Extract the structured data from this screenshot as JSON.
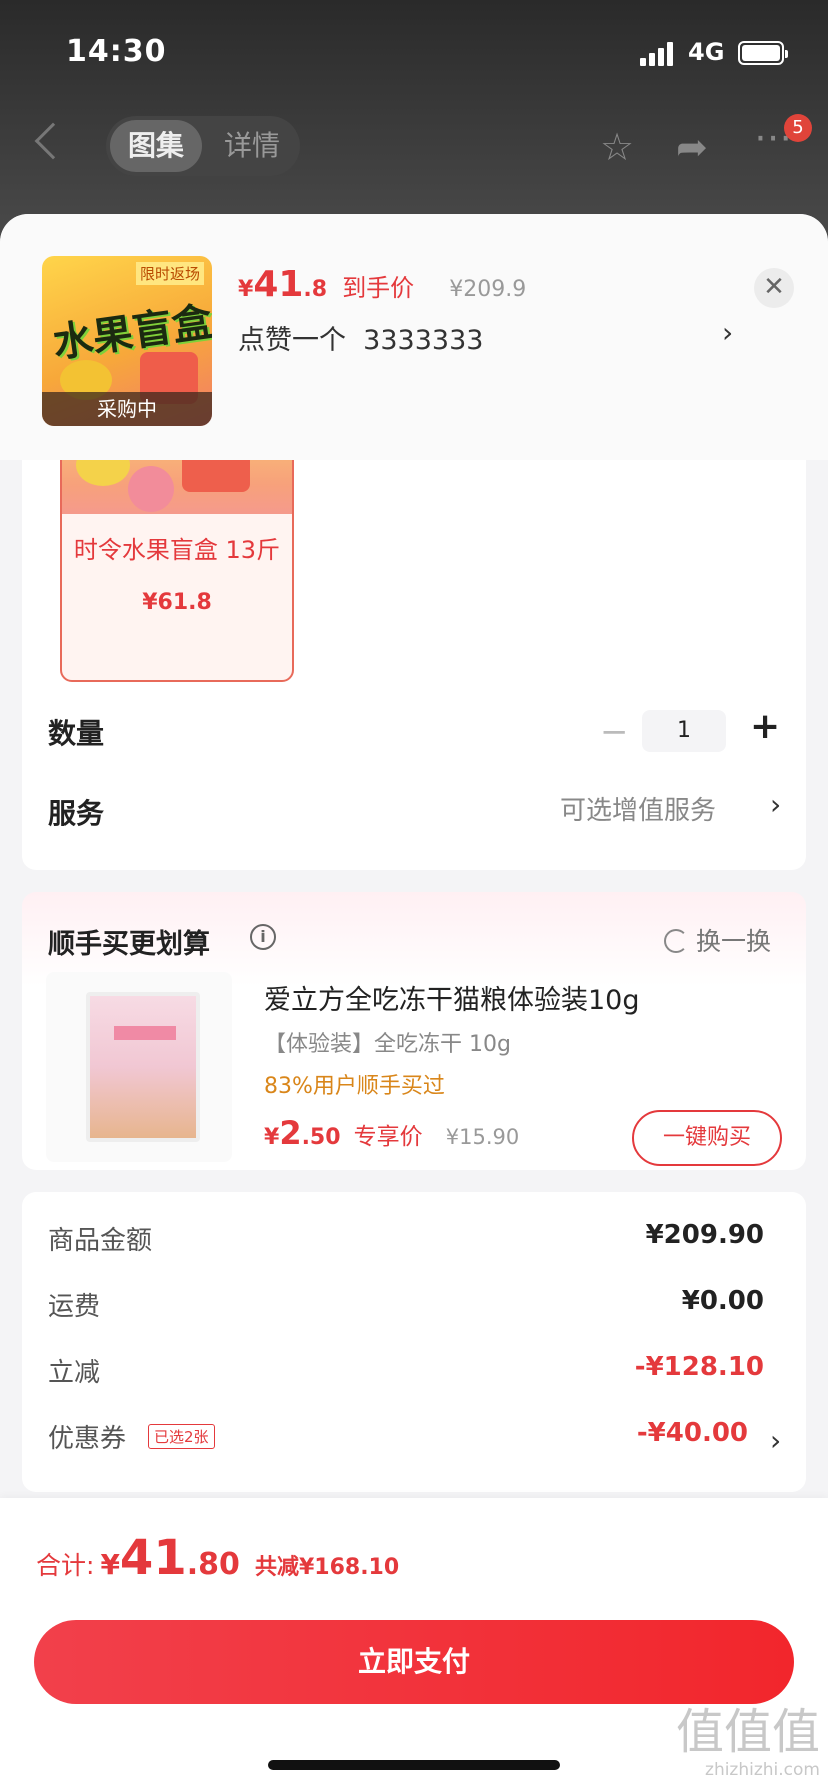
{
  "status_bar": {
    "time": "14:30",
    "network": "4G"
  },
  "nav": {
    "tabs": [
      {
        "label": "图集"
      },
      {
        "label": "详情"
      }
    ],
    "more_badge": "5"
  },
  "sheet": {
    "thumbnail": {
      "tag": "限时返场",
      "title": "水果盲盒",
      "status": "采购中"
    },
    "price": {
      "yen": "¥",
      "integer": "41",
      "decimal": ".8",
      "label": "到手价",
      "original": "¥209.9"
    },
    "spec": {
      "selected": "点赞一个",
      "code": "3333333"
    }
  },
  "sku": {
    "name": "时令水果盲盒 13斤",
    "price": "¥61.8"
  },
  "quantity": {
    "label": "数量",
    "value": "1"
  },
  "service": {
    "label": "服务",
    "value": "可选增值服务"
  },
  "recommend": {
    "title": "顺手买更划算",
    "swap_label": "换一换",
    "product": {
      "name": "爱立方全吃冻干猫粮体验装10g",
      "subtitle": "【体验装】全吃冻干 10g",
      "buyers": "83%用户顺手买过",
      "price_yen": "¥",
      "price_int": "2",
      "price_dec": ".50",
      "price_label": "专享价",
      "original": "¥15.90",
      "buy_label": "一键购买"
    }
  },
  "summary": {
    "rows": [
      {
        "label": "商品金额",
        "value": "¥209.90"
      },
      {
        "label": "运费",
        "value": "¥0.00"
      },
      {
        "label": "立减",
        "value": "-¥128.10"
      },
      {
        "label": "优惠券",
        "value": "-¥40.00",
        "tag": "已选2张"
      }
    ]
  },
  "footer": {
    "total_label": "合计:",
    "total_yen": "¥",
    "total_int": "41",
    "total_dec": ".80",
    "total_saved": "共减¥168.10",
    "pay_label": "立即支付"
  },
  "watermark": {
    "text": "值值值",
    "sub": "zhizhizhi.com"
  },
  "colors": {
    "accent": "#e4393c",
    "buyers": "#d9861a"
  }
}
